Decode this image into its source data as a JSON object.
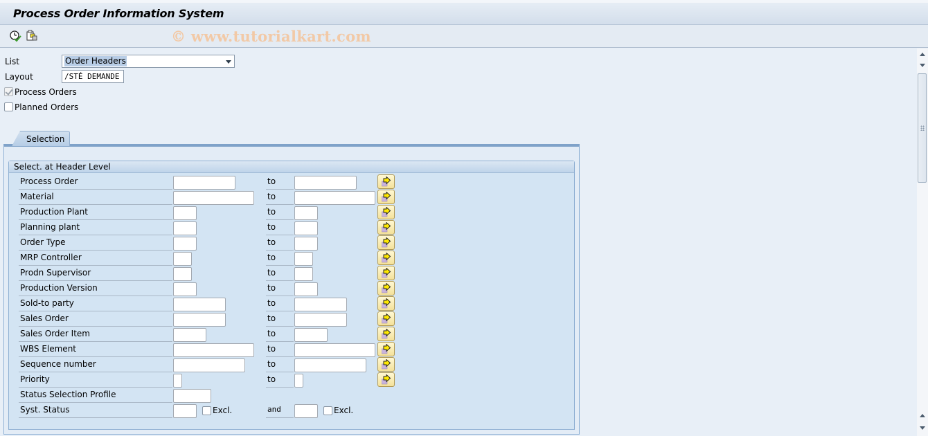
{
  "window": {
    "title": "Process Order Information System",
    "watermark": "© www.tutorialkart.com"
  },
  "toolbar": {
    "icons": [
      {
        "name": "execute-icon",
        "description": "clock with green check"
      },
      {
        "name": "copy-selection-icon",
        "description": "documents"
      }
    ]
  },
  "header_fields": {
    "list_label": "List",
    "list_value": "Order Headers",
    "layout_label": "Layout",
    "layout_value": "/STÉ DEMANDE",
    "process_orders_label": "Process Orders",
    "process_orders_checked": true,
    "planned_orders_label": "Planned Orders",
    "planned_orders_checked": false
  },
  "tabs": [
    {
      "label": "Selection",
      "active": true
    }
  ],
  "selection": {
    "group_title": "Select. at Header Level",
    "to_label": "to",
    "and_label": "and",
    "excl_label": "Excl.",
    "rows": [
      {
        "label": "Process Order",
        "from": "",
        "to": "",
        "has_range": true
      },
      {
        "label": "Material",
        "from": "",
        "to": "",
        "has_range": true
      },
      {
        "label": "Production Plant",
        "from": "",
        "to": "",
        "has_range": true
      },
      {
        "label": "Planning plant",
        "from": "",
        "to": "",
        "has_range": true
      },
      {
        "label": "Order Type",
        "from": "",
        "to": "",
        "has_range": true
      },
      {
        "label": "MRP Controller",
        "from": "",
        "to": "",
        "has_range": true
      },
      {
        "label": "Prodn Supervisor",
        "from": "",
        "to": "",
        "has_range": true
      },
      {
        "label": "Production Version",
        "from": "",
        "to": "",
        "has_range": true
      },
      {
        "label": "Sold-to party",
        "from": "",
        "to": "",
        "has_range": true
      },
      {
        "label": "Sales Order",
        "from": "",
        "to": "",
        "has_range": true
      },
      {
        "label": "Sales Order Item",
        "from": "",
        "to": "",
        "has_range": true
      },
      {
        "label": "WBS Element",
        "from": "",
        "to": "",
        "has_range": true
      },
      {
        "label": "Sequence number",
        "from": "",
        "to": "",
        "has_range": true
      },
      {
        "label": "Priority",
        "from": "",
        "to": "",
        "has_range": true
      },
      {
        "label": "Status Selection Profile",
        "from": "",
        "has_range": false
      },
      {
        "label": "Syst. Status",
        "from": "",
        "to": "",
        "excl1": false,
        "excl2": false
      }
    ]
  }
}
